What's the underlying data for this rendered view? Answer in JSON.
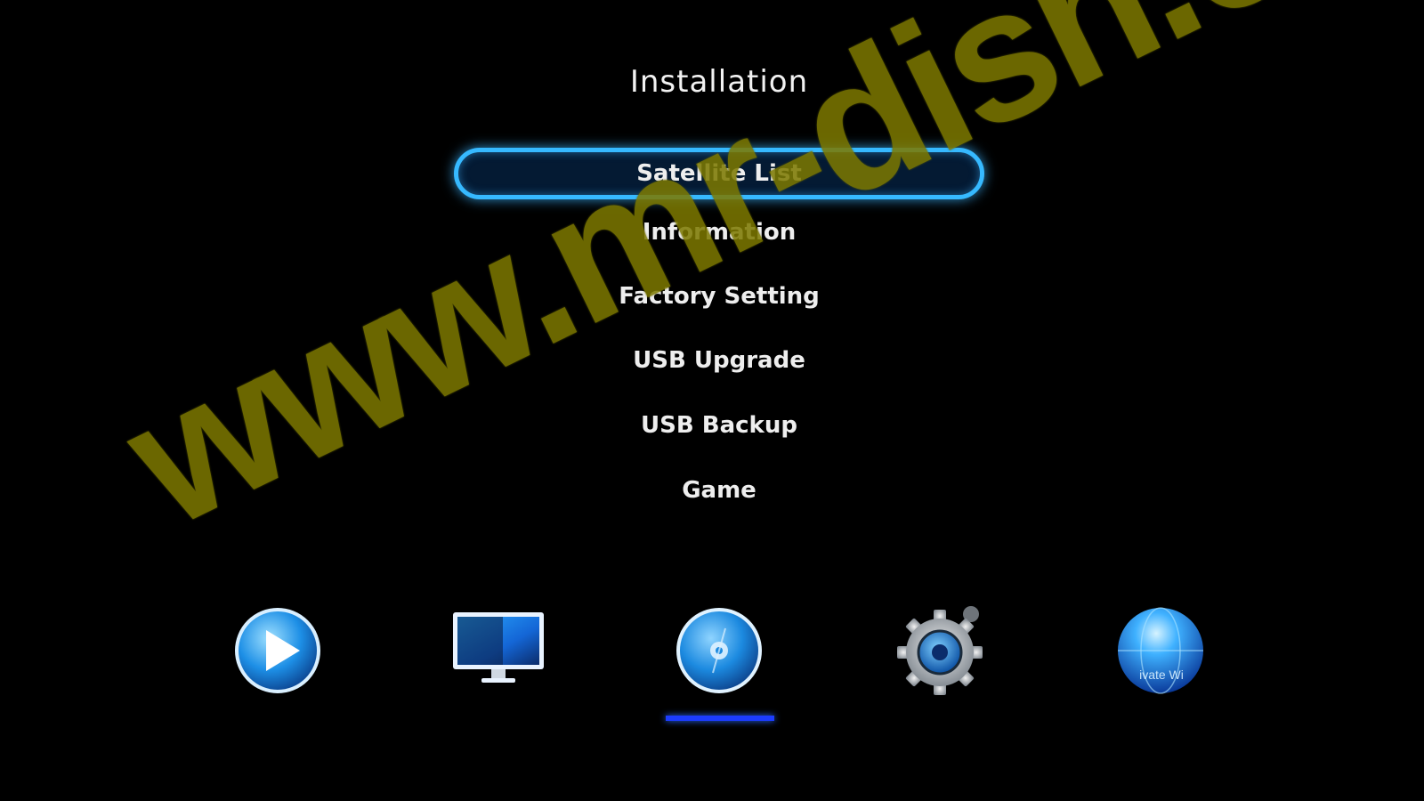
{
  "screen": {
    "title": "Installation"
  },
  "menu": {
    "items": [
      {
        "label": "Satellite List",
        "selected": true
      },
      {
        "label": "Information",
        "selected": false
      },
      {
        "label": "Factory Setting",
        "selected": false
      },
      {
        "label": "USB Upgrade",
        "selected": false
      },
      {
        "label": "USB Backup",
        "selected": false
      },
      {
        "label": "Game",
        "selected": false
      }
    ]
  },
  "dock": {
    "items": [
      {
        "icon": "media-play-icon"
      },
      {
        "icon": "tv-monitor-icon"
      },
      {
        "icon": "installation-disc-icon",
        "active": true
      },
      {
        "icon": "settings-gear-icon"
      },
      {
        "icon": "globe-network-icon",
        "caption": "ivate Wi"
      }
    ]
  },
  "watermark": {
    "text": "www.mr-dish.com"
  },
  "colors": {
    "accent": "#36b9ff",
    "active_bar": "#1c3cff",
    "watermark": "#7d7900"
  }
}
